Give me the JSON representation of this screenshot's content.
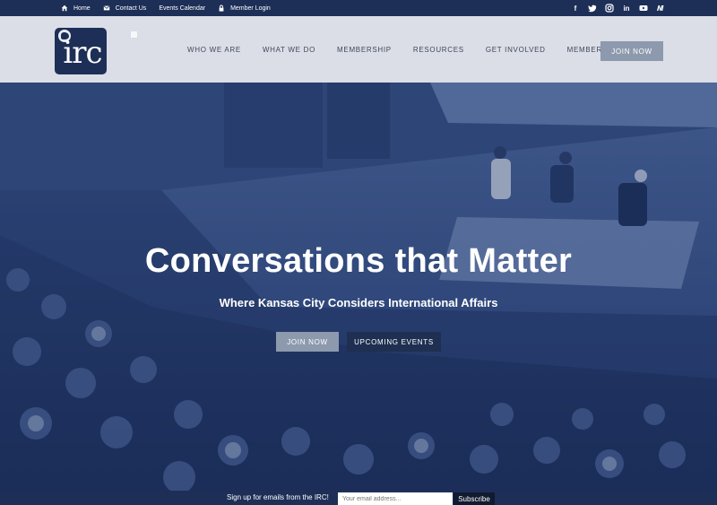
{
  "topbar": {
    "links": [
      {
        "label": "Home",
        "icon": "home-icon"
      },
      {
        "label": "Contact Us",
        "icon": "mail-icon"
      },
      {
        "label": "Events Calendar",
        "icon": ""
      },
      {
        "label": "Member Login",
        "icon": "lock-icon"
      }
    ],
    "social": [
      "facebook-icon",
      "twitter-icon",
      "instagram-icon",
      "linkedin-icon",
      "youtube-icon",
      "medium-icon"
    ]
  },
  "header": {
    "logo_text": "irc",
    "nav": [
      "WHO WE ARE",
      "WHAT WE DO",
      "MEMBERSHIP",
      "RESOURCES",
      "GET INVOLVED",
      "MEMBERS ONLY"
    ],
    "join_label": "JOIN NOW"
  },
  "hero": {
    "title": "Conversations that Matter",
    "subtitle": "Where Kansas City Considers International Affairs",
    "join_label": "JOIN NOW",
    "events_label": "UPCOMING EVENTS"
  },
  "signup": {
    "label": "Sign up for emails from the IRC!",
    "placeholder": "Your email address...",
    "button": "Subscribe"
  },
  "colors": {
    "navy": "#1d2f57",
    "accent_grey_blue": "#8d99ad",
    "hero_blue": "#2f4677"
  }
}
